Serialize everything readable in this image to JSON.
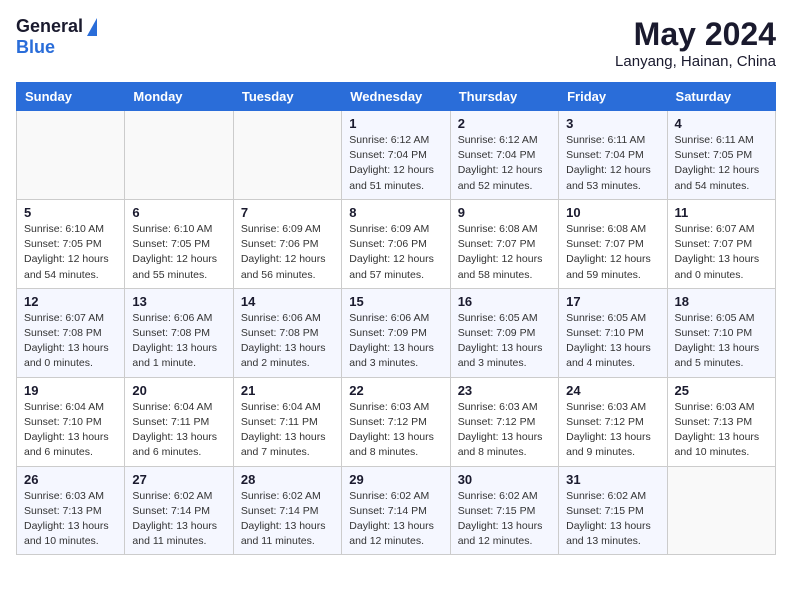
{
  "logo": {
    "general": "General",
    "blue": "Blue"
  },
  "title": "May 2024",
  "location": "Lanyang, Hainan, China",
  "weekdays": [
    "Sunday",
    "Monday",
    "Tuesday",
    "Wednesday",
    "Thursday",
    "Friday",
    "Saturday"
  ],
  "weeks": [
    [
      {
        "day": "",
        "info": ""
      },
      {
        "day": "",
        "info": ""
      },
      {
        "day": "",
        "info": ""
      },
      {
        "day": "1",
        "info": "Sunrise: 6:12 AM\nSunset: 7:04 PM\nDaylight: 12 hours\nand 51 minutes."
      },
      {
        "day": "2",
        "info": "Sunrise: 6:12 AM\nSunset: 7:04 PM\nDaylight: 12 hours\nand 52 minutes."
      },
      {
        "day": "3",
        "info": "Sunrise: 6:11 AM\nSunset: 7:04 PM\nDaylight: 12 hours\nand 53 minutes."
      },
      {
        "day": "4",
        "info": "Sunrise: 6:11 AM\nSunset: 7:05 PM\nDaylight: 12 hours\nand 54 minutes."
      }
    ],
    [
      {
        "day": "5",
        "info": "Sunrise: 6:10 AM\nSunset: 7:05 PM\nDaylight: 12 hours\nand 54 minutes."
      },
      {
        "day": "6",
        "info": "Sunrise: 6:10 AM\nSunset: 7:05 PM\nDaylight: 12 hours\nand 55 minutes."
      },
      {
        "day": "7",
        "info": "Sunrise: 6:09 AM\nSunset: 7:06 PM\nDaylight: 12 hours\nand 56 minutes."
      },
      {
        "day": "8",
        "info": "Sunrise: 6:09 AM\nSunset: 7:06 PM\nDaylight: 12 hours\nand 57 minutes."
      },
      {
        "day": "9",
        "info": "Sunrise: 6:08 AM\nSunset: 7:07 PM\nDaylight: 12 hours\nand 58 minutes."
      },
      {
        "day": "10",
        "info": "Sunrise: 6:08 AM\nSunset: 7:07 PM\nDaylight: 12 hours\nand 59 minutes."
      },
      {
        "day": "11",
        "info": "Sunrise: 6:07 AM\nSunset: 7:07 PM\nDaylight: 13 hours\nand 0 minutes."
      }
    ],
    [
      {
        "day": "12",
        "info": "Sunrise: 6:07 AM\nSunset: 7:08 PM\nDaylight: 13 hours\nand 0 minutes."
      },
      {
        "day": "13",
        "info": "Sunrise: 6:06 AM\nSunset: 7:08 PM\nDaylight: 13 hours\nand 1 minute."
      },
      {
        "day": "14",
        "info": "Sunrise: 6:06 AM\nSunset: 7:08 PM\nDaylight: 13 hours\nand 2 minutes."
      },
      {
        "day": "15",
        "info": "Sunrise: 6:06 AM\nSunset: 7:09 PM\nDaylight: 13 hours\nand 3 minutes."
      },
      {
        "day": "16",
        "info": "Sunrise: 6:05 AM\nSunset: 7:09 PM\nDaylight: 13 hours\nand 3 minutes."
      },
      {
        "day": "17",
        "info": "Sunrise: 6:05 AM\nSunset: 7:10 PM\nDaylight: 13 hours\nand 4 minutes."
      },
      {
        "day": "18",
        "info": "Sunrise: 6:05 AM\nSunset: 7:10 PM\nDaylight: 13 hours\nand 5 minutes."
      }
    ],
    [
      {
        "day": "19",
        "info": "Sunrise: 6:04 AM\nSunset: 7:10 PM\nDaylight: 13 hours\nand 6 minutes."
      },
      {
        "day": "20",
        "info": "Sunrise: 6:04 AM\nSunset: 7:11 PM\nDaylight: 13 hours\nand 6 minutes."
      },
      {
        "day": "21",
        "info": "Sunrise: 6:04 AM\nSunset: 7:11 PM\nDaylight: 13 hours\nand 7 minutes."
      },
      {
        "day": "22",
        "info": "Sunrise: 6:03 AM\nSunset: 7:12 PM\nDaylight: 13 hours\nand 8 minutes."
      },
      {
        "day": "23",
        "info": "Sunrise: 6:03 AM\nSunset: 7:12 PM\nDaylight: 13 hours\nand 8 minutes."
      },
      {
        "day": "24",
        "info": "Sunrise: 6:03 AM\nSunset: 7:12 PM\nDaylight: 13 hours\nand 9 minutes."
      },
      {
        "day": "25",
        "info": "Sunrise: 6:03 AM\nSunset: 7:13 PM\nDaylight: 13 hours\nand 10 minutes."
      }
    ],
    [
      {
        "day": "26",
        "info": "Sunrise: 6:03 AM\nSunset: 7:13 PM\nDaylight: 13 hours\nand 10 minutes."
      },
      {
        "day": "27",
        "info": "Sunrise: 6:02 AM\nSunset: 7:14 PM\nDaylight: 13 hours\nand 11 minutes."
      },
      {
        "day": "28",
        "info": "Sunrise: 6:02 AM\nSunset: 7:14 PM\nDaylight: 13 hours\nand 11 minutes."
      },
      {
        "day": "29",
        "info": "Sunrise: 6:02 AM\nSunset: 7:14 PM\nDaylight: 13 hours\nand 12 minutes."
      },
      {
        "day": "30",
        "info": "Sunrise: 6:02 AM\nSunset: 7:15 PM\nDaylight: 13 hours\nand 12 minutes."
      },
      {
        "day": "31",
        "info": "Sunrise: 6:02 AM\nSunset: 7:15 PM\nDaylight: 13 hours\nand 13 minutes."
      },
      {
        "day": "",
        "info": ""
      }
    ]
  ]
}
